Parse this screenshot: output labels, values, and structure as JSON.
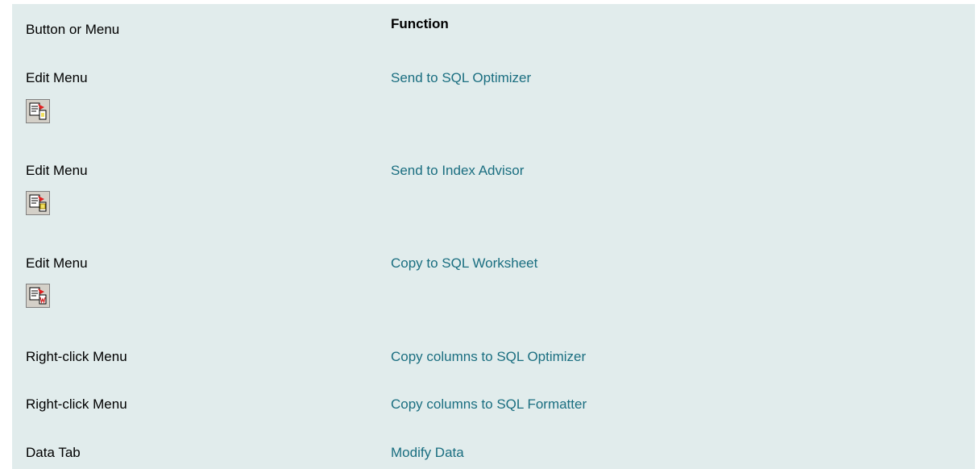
{
  "table": {
    "header": {
      "col1": "Button or Menu",
      "col2": "Function"
    },
    "rows": [
      {
        "source": "Edit Menu",
        "function": "Send to SQL Optimizer",
        "icon": "send-to-sql-optimizer-icon"
      },
      {
        "source": "Edit Menu",
        "function": "Send to Index Advisor",
        "icon": "send-to-index-advisor-icon"
      },
      {
        "source": "Edit Menu",
        "function": "Copy to SQL Worksheet",
        "icon": "copy-to-sql-worksheet-icon"
      },
      {
        "source": "Right-click Menu",
        "function": "Copy columns to SQL Optimizer"
      },
      {
        "source": "Right-click Menu",
        "function": "Copy columns to SQL Formatter"
      },
      {
        "source": "Data Tab",
        "function": "Modify Data"
      }
    ]
  },
  "colors": {
    "background": "#e1ecec",
    "link": "#1a6e80"
  }
}
